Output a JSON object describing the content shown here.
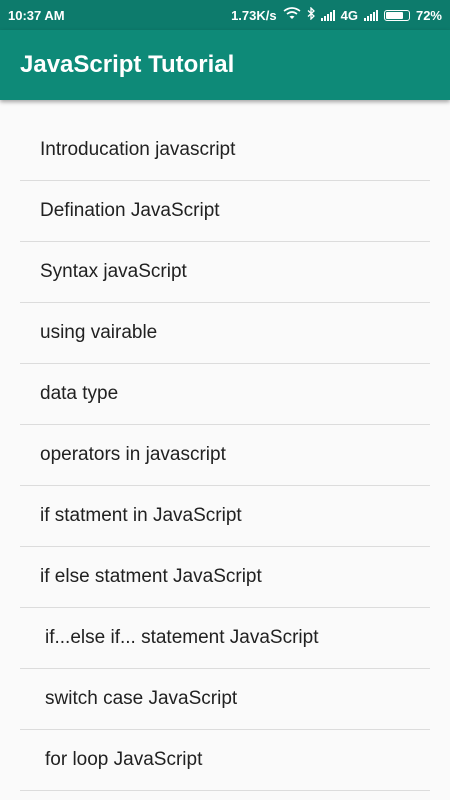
{
  "status_bar": {
    "time": "10:37 AM",
    "speed": "1.73K/s",
    "network": "4G",
    "battery": "72%",
    "icons": [
      "wifi-icon",
      "bluetooth-icon",
      "signal-icon",
      "signal-icon",
      "battery-icon"
    ]
  },
  "app_bar": {
    "title": "JavaScript Tutorial"
  },
  "list": {
    "items": [
      "Introducation javascript",
      "Defination JavaScript",
      "Syntax javaScript",
      "using vairable",
      "data type",
      "operators in javascript",
      "if statment in JavaScript",
      "if else statment JavaScript",
      "if...else if... statement JavaScript",
      "switch case JavaScript",
      "for loop JavaScript"
    ]
  },
  "colors": {
    "status_bar": "#0d7b6c",
    "app_bar": "#0e8a78",
    "background": "#fafafa",
    "divider": "#dcdcdc"
  }
}
